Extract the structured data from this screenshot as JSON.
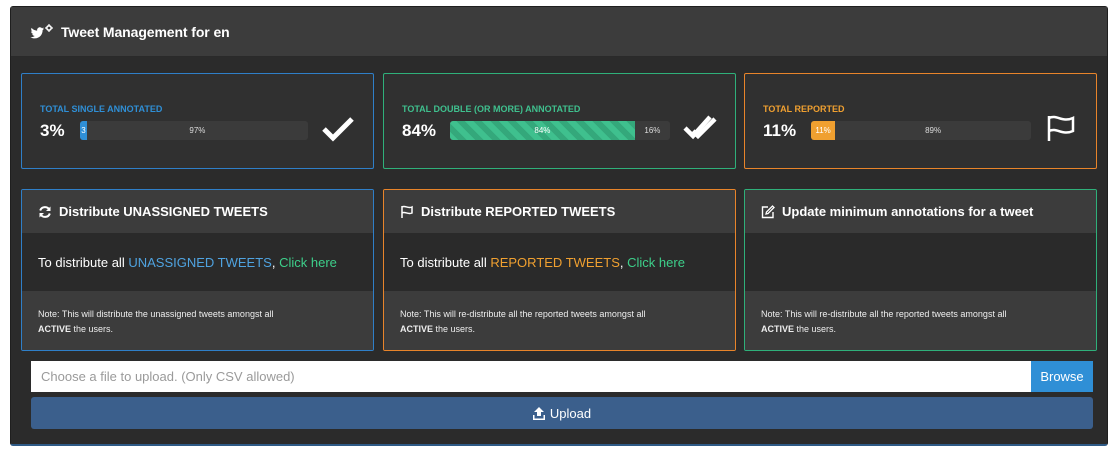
{
  "header": {
    "title": "Tweet Management for en"
  },
  "stats": [
    {
      "label": "TOTAL SINGLE ANNOTATED",
      "percent_label": "3%",
      "fill_fraction": 0.03,
      "fill_text": "3",
      "rest_text": "97%",
      "accent": "#2f7fc8",
      "fill_color": "#2f8fd6",
      "icon": "check-icon"
    },
    {
      "label": "TOTAL DOUBLE (OR MORE) ANNOTATED",
      "percent_label": "84%",
      "fill_fraction": 0.84,
      "fill_text": "84%",
      "rest_text": "16%",
      "accent": "#2fb07a",
      "fill_color": "#3fc08e",
      "icon": "double-check-icon"
    },
    {
      "label": "TOTAL REPORTED",
      "percent_label": "11%",
      "fill_fraction": 0.11,
      "fill_text": "11%",
      "rest_text": "89%",
      "accent": "#e8842a",
      "fill_color": "#f0a030",
      "icon": "flag-icon"
    }
  ],
  "actions": [
    {
      "title": "Distribute UNASSIGNED TWEETS",
      "icon": "refresh-icon",
      "prefix": "To distribute all ",
      "highlight": "UNASSIGNED TWEETS",
      "comma": ",",
      "link": "Click here",
      "note_pre": "Note: This will distribute the unassigned tweets amongst all",
      "note_bold": "ACTIVE",
      "note_post": " the users.",
      "accent": "#2f7fc8"
    },
    {
      "title": "Distribute REPORTED TWEETS",
      "icon": "flag-icon",
      "prefix": "To distribute all ",
      "highlight": "REPORTED TWEETS",
      "comma": ",",
      "link": "Click here",
      "note_pre": "Note: This will re-distribute all the reported tweets amongst all",
      "note_bold": "ACTIVE",
      "note_post": " the users.",
      "accent": "#e8842a"
    },
    {
      "title": "Update minimum annotations for a tweet",
      "icon": "edit-icon",
      "note_pre": "Note: This will re-distribute all the reported tweets amongst all",
      "note_bold": "ACTIVE",
      "note_post": " the users.",
      "accent": "#2fb07a"
    }
  ],
  "upload": {
    "placeholder": "Choose a file to upload. (Only CSV allowed)",
    "browse_label": "Browse",
    "upload_label": "Upload"
  },
  "colors": {
    "link_green": "#3dcf8a",
    "upload_button": "#3b5f8c",
    "browse_button": "#2f8fd6"
  }
}
